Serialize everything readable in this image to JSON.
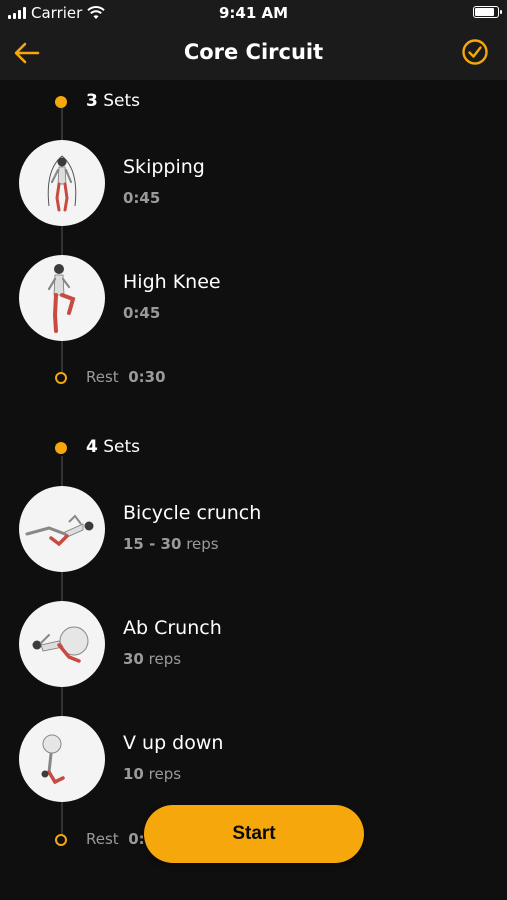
{
  "status_bar": {
    "carrier": "Carrier",
    "time": "9:41 AM"
  },
  "nav": {
    "title": "Core Circuit"
  },
  "colors": {
    "accent": "#f5a70b",
    "background": "#0f0f0f",
    "muted": "#9a9a9a"
  },
  "groups": [
    {
      "sets_count": "3",
      "sets_word": "Sets",
      "exercises": [
        {
          "name": "Skipping",
          "value": "0:45",
          "unit": "",
          "icon": "jump-rope-figure"
        },
        {
          "name": "High Knee",
          "value": "0:45",
          "unit": "",
          "icon": "high-knee-figure"
        }
      ],
      "rest": {
        "label": "Rest",
        "value": "0:30"
      }
    },
    {
      "sets_count": "4",
      "sets_word": "Sets",
      "exercises": [
        {
          "name": "Bicycle crunch",
          "value": "15 - 30",
          "unit": "reps",
          "icon": "bicycle-crunch-figure"
        },
        {
          "name": "Ab Crunch",
          "value": "30",
          "unit": "reps",
          "icon": "ab-crunch-figure"
        },
        {
          "name": "V up down",
          "value": "10",
          "unit": "reps",
          "icon": "v-up-figure"
        }
      ],
      "rest": {
        "label": "Rest",
        "value": "0:"
      }
    }
  ],
  "start_button": {
    "label": "Start"
  }
}
